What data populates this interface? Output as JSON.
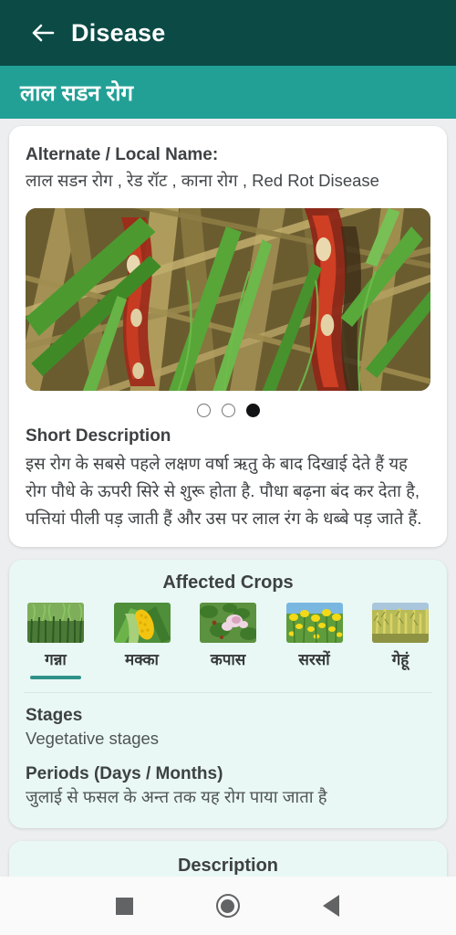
{
  "appbar": {
    "back_icon": "back-arrow-icon",
    "title": "Disease"
  },
  "subbar": {
    "title": "लाल सडन रोग"
  },
  "info_card": {
    "alternate_label": "Alternate / Local Name:",
    "alternate_value": "लाल सडन रोग , रेड रॉट , काना रोग , Red Rot Disease",
    "hero_image_alt": "sugarcane-red-rot-lesions",
    "carousel": {
      "total": 3,
      "active_index": 2
    },
    "short_description_label": "Short Description",
    "short_description_text": "इस रोग के सबसे पहले लक्षण वर्षा ऋतु के बाद दिखाई देते हैं यह रोग पौधे के ऊपरी सिरे से शुरू होता है. पौधा बढ़ना बंद कर देता है, पत्तियां पीली पड़ जाती हैं और उस पर लाल रंग के धब्बे पड़ जाते हैं."
  },
  "affected_crops": {
    "title": "Affected Crops",
    "selected_index": 0,
    "items": [
      {
        "label": "गन्ना",
        "image": "sugarcane-field-thumb"
      },
      {
        "label": "मक्का",
        "image": "maize-cob-thumb"
      },
      {
        "label": "कपास",
        "image": "cotton-plant-thumb"
      },
      {
        "label": "सरसों",
        "image": "mustard-field-thumb"
      },
      {
        "label": "गेहूं",
        "image": "wheat-field-thumb"
      }
    ],
    "stages_label": "Stages",
    "stages_value": "Vegetative stages",
    "periods_label": "Periods (Days / Months)",
    "periods_value": "जुलाई से फसल के अन्त तक यह रोग पाया जाता है"
  },
  "description_card": {
    "title": "Description"
  },
  "navbar": {
    "recents": "recents-square-icon",
    "home": "home-circle-icon",
    "back": "back-triangle-icon"
  },
  "colors": {
    "appbar_bg": "#0b4a45",
    "subbar_bg": "#23a096",
    "page_bg": "#eceef0",
    "mint_card": "#e9f8f4",
    "accent_underline": "#2f928a"
  }
}
